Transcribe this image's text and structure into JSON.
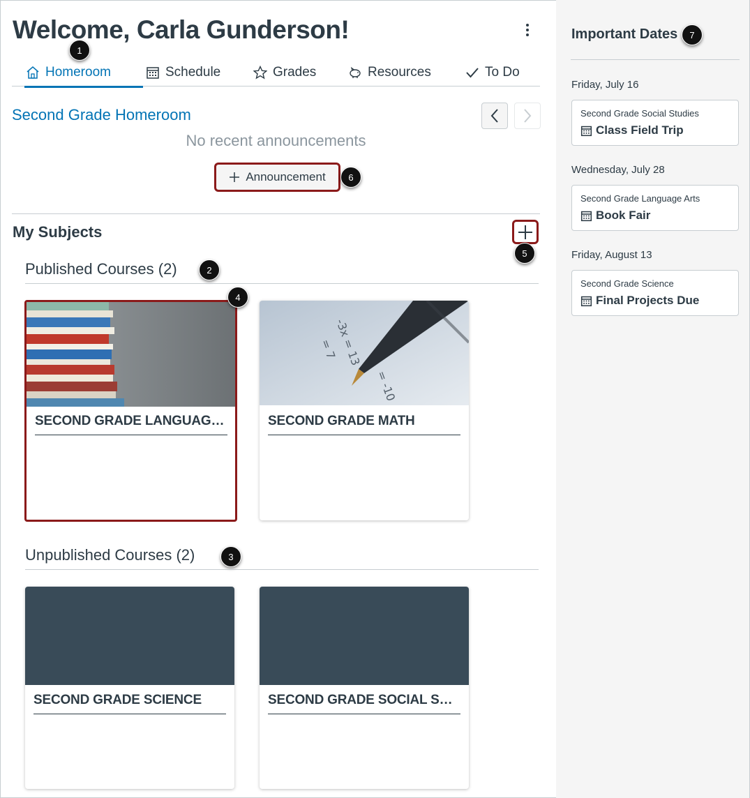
{
  "header": {
    "title": "Welcome, Carla Gunderson!"
  },
  "tabs": [
    {
      "label": "Homeroom",
      "icon": "home-icon",
      "active": true
    },
    {
      "label": "Schedule",
      "icon": "calendar-icon",
      "active": false
    },
    {
      "label": "Grades",
      "icon": "star-icon",
      "active": false
    },
    {
      "label": "Resources",
      "icon": "piggy-bank-icon",
      "active": false
    },
    {
      "label": "To Do",
      "icon": "checkmark-icon",
      "active": false
    }
  ],
  "homeroom": {
    "link_label": "Second Grade Homeroom",
    "empty_text": "No recent announcements",
    "announcement_button": "Announcement"
  },
  "subjects": {
    "title": "My Subjects",
    "published_heading": "Published Courses (2)",
    "unpublished_heading": "Unpublished Courses (2)",
    "published": [
      {
        "name": "SECOND GRADE LANGUAGE ARTS",
        "image": "stacked-books"
      },
      {
        "name": "SECOND GRADE MATH",
        "image": "pen-on-math-worksheet"
      }
    ],
    "unpublished": [
      {
        "name": "SECOND GRADE SCIENCE",
        "color": "#394b58"
      },
      {
        "name": "SECOND GRADE SOCIAL STUDIES",
        "color": "#394b58"
      }
    ]
  },
  "sidebar": {
    "title": "Important Dates",
    "dates": [
      {
        "date": "Friday, July 16",
        "course": "Second Grade Social Studies",
        "event": "Class Field Trip"
      },
      {
        "date": "Wednesday, July 28",
        "course": "Second Grade Language Arts",
        "event": "Book Fair"
      },
      {
        "date": "Friday, August 13",
        "course": "Second Grade Science",
        "event": "Final Projects Due"
      }
    ]
  },
  "markers": [
    "1",
    "2",
    "3",
    "4",
    "5",
    "6",
    "7"
  ],
  "colors": {
    "accent": "#0374b5",
    "text": "#2d3b45",
    "highlight": "#8b1a1a",
    "unpublished_card": "#394b58",
    "sidebar_bg": "#f5f5f5"
  }
}
